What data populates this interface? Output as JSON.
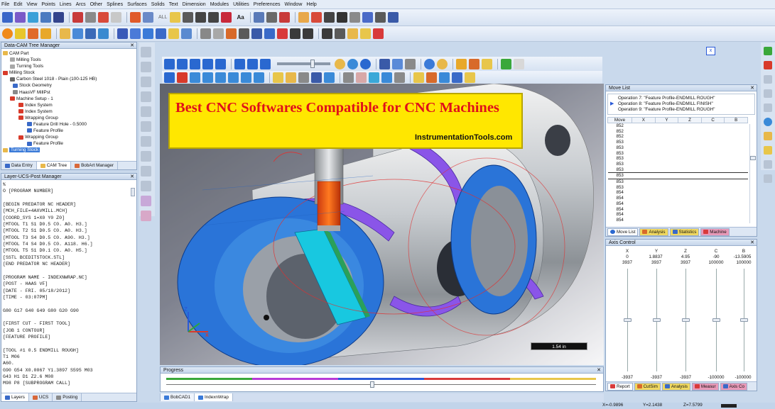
{
  "menu": [
    "File",
    "Edit",
    "View",
    "Points",
    "Lines",
    "Arcs",
    "Other",
    "Splines",
    "Surfaces",
    "Solids",
    "Text",
    "Dimension",
    "Modules",
    "Utilities",
    "Preferences",
    "Window",
    "Help"
  ],
  "toolbar": {
    "all_label": "ALL",
    "text_tool_label": "Aa"
  },
  "cam_tree": {
    "title": "Data-CAM Tree Manager",
    "items": [
      {
        "label": "CAM Part",
        "depth": 0
      },
      {
        "label": "Milling Tools",
        "depth": 1
      },
      {
        "label": "Turning Tools",
        "depth": 1
      },
      {
        "label": "Milling Stock",
        "depth": 0
      },
      {
        "label": "Carbon Steel 1018 - Plain (100-125 HB)",
        "depth": 1
      },
      {
        "label": "Stock Geometry",
        "depth": 1
      },
      {
        "label": "HaasVF MillPst",
        "depth": 1
      },
      {
        "label": "Machine Setup - 1",
        "depth": 1
      },
      {
        "label": "Index System",
        "depth": 2
      },
      {
        "label": "Index System",
        "depth": 2
      },
      {
        "label": "Wrapping Group",
        "depth": 2
      },
      {
        "label": "Feature Drill Hole - 0.5000",
        "depth": 3
      },
      {
        "label": "Feature Profile",
        "depth": 3
      },
      {
        "label": "Wrapping Group",
        "depth": 2
      },
      {
        "label": "Feature Profile",
        "depth": 3
      },
      {
        "label": "Turning Stock",
        "depth": 0,
        "selected": true
      }
    ],
    "tabs": [
      "Data Entry",
      "CAM Tree",
      "BobArt Manager"
    ]
  },
  "post_panel": {
    "title": "Layer-UCS-Post Manager",
    "lines": [
      "%",
      "O [PROGRAM NUMBER]",
      "",
      "[BEGIN PREDATOR NC HEADER]",
      "[MCH_FILE=4AXVMILL.MCH]",
      "[COORD_SYS 1=X0 Y0 Z0]",
      "[MTOOL T1 S1 D0.5 C0. A0. H3.]",
      "[MTOOL T2 S1 D0.5 C0. A0. H3.]",
      "[MTOOL T3 S4 D0.5 C0. A90. H3.]",
      "[MTOOL T4 S4 D0.5 C0. A118. H6.]",
      "[MTOOL T5 S1 D0.1 C0. A0. H5.]",
      "[SSTL BCEDITSTOCK.STL]",
      "[END PREDATOR NC HEADER]",
      "",
      "[PROGRAM NAME - INDEXNWRAP.NC]",
      "[POST - HAAS VF]",
      "[DATE - FRI. 05/18/2012]",
      "[TIME - 03:07PM]",
      "",
      "G80 G17 G40 G49 G80 G20 G90",
      "",
      "[FIRST CUT - FIRST TOOL]",
      "[JOB 1 CONTOUR]",
      "[FEATURE PROFILE]",
      "",
      "[TOOL #1 0.5 ENDMILL ROUGH]",
      "T1 M06",
      "A60.",
      "G90 G54 X0.0067 Y1.3897 S595 M03",
      "G43 H1 D1 Z2.6 M08",
      "M98 P8 [SUBPROGRAM CALL]"
    ],
    "tabs": [
      "Layers",
      "UCS",
      "Posting"
    ]
  },
  "banner": {
    "title": "Best CNC Softwares Compatible for CNC Machines",
    "site": "InstrumentationTools.com"
  },
  "viewport": {
    "scale_label": "1.54 in",
    "axis_z": "Z",
    "axis_x": "X",
    "cancel_label": "x"
  },
  "progress": {
    "title": "Progress",
    "value": 0.48
  },
  "doc_tabs": [
    "BobCAD1",
    "IndexnWrap"
  ],
  "move_list": {
    "title": "Move List",
    "operations": [
      "Operation 7: \"Feature Profile-ENDMILL ROUGH\"",
      "Operation 8: \"Feature Profile-ENDMILL FINISH\"",
      "Operation 9: \"Feature Profile-ENDMILL ROUGH\""
    ],
    "columns": [
      "Move",
      "X",
      "Y",
      "Z",
      "C",
      "B"
    ],
    "rows": [
      "852",
      "852",
      "852",
      "853",
      "853",
      "853",
      "853",
      "853",
      "853",
      "853",
      "853",
      "853",
      "854",
      "854",
      "854",
      "854",
      "854",
      "854"
    ],
    "current_row": "853",
    "tabs": [
      "Move List",
      "Analysis",
      "Statistics",
      "Machine"
    ]
  },
  "axis_control": {
    "title": "Axis Control",
    "headers": [
      "X",
      "Y",
      "Z",
      "C",
      "B"
    ],
    "current": [
      "0",
      "1.8837",
      "4.95",
      "-90",
      "-13.5905"
    ],
    "max": [
      "3937",
      "3937",
      "3937",
      "100000",
      "100000"
    ],
    "min": [
      "-3937",
      "-3937",
      "-3937",
      "-100000",
      "-100000"
    ],
    "slider_levels": [
      0.5,
      0.5,
      0.5,
      0.5,
      0.5
    ],
    "tabs": [
      "Report",
      "CutSim",
      "Analysis",
      "Measur",
      "Axis Co"
    ]
  },
  "status_bar": {
    "x": "X=-0.9896",
    "y": "Y=2.1438",
    "z": "Z=7.5799"
  }
}
